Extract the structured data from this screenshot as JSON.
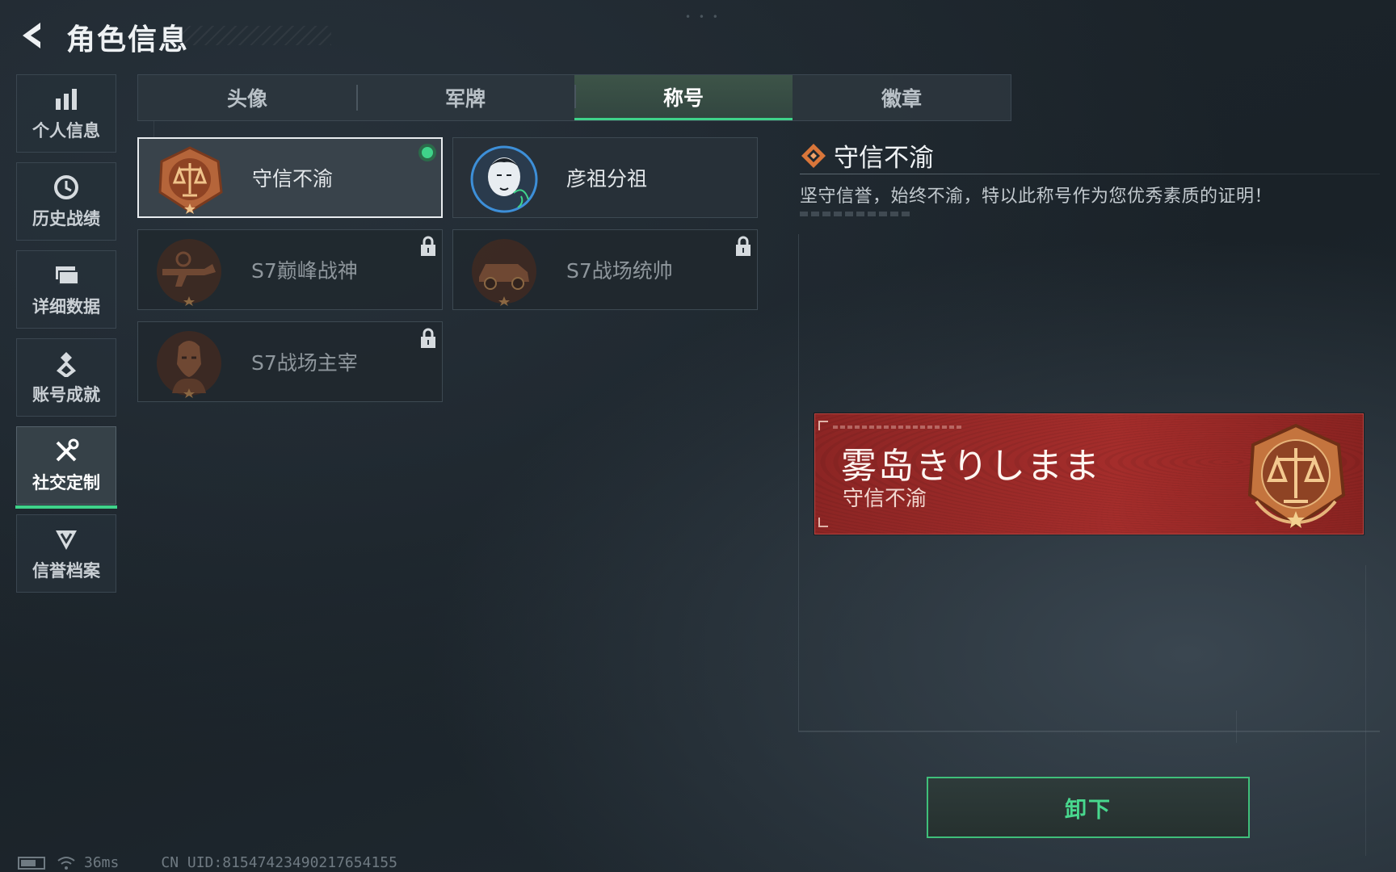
{
  "header": {
    "title": "角色信息",
    "back_icon": "back-arrow-icon"
  },
  "sidenav": {
    "items": [
      {
        "label": "个人信息",
        "icon": "bar-chart-icon"
      },
      {
        "label": "历史战绩",
        "icon": "history-clock-icon"
      },
      {
        "label": "详细数据",
        "icon": "folder-icon"
      },
      {
        "label": "账号成就",
        "icon": "medal-icon"
      },
      {
        "label": "社交定制",
        "icon": "tools-icon",
        "active": true
      },
      {
        "label": "信誉档案",
        "icon": "shield-chevron-icon"
      }
    ]
  },
  "tabs": [
    {
      "label": "头像"
    },
    {
      "label": "军牌"
    },
    {
      "label": "称号",
      "active": true
    },
    {
      "label": "徽章"
    }
  ],
  "titles": [
    {
      "name": "守信不渝",
      "state": "equipped",
      "icon": "scales-emblem-icon"
    },
    {
      "name": "彦祖分祖",
      "state": "unlocked",
      "icon": "portrait-emblem-icon"
    },
    {
      "name": "S7巅峰战神",
      "state": "locked",
      "icon": "weapon-emblem-icon"
    },
    {
      "name": "S7战场统帅",
      "state": "locked",
      "icon": "vehicle-emblem-icon"
    },
    {
      "name": "S7战场主宰",
      "state": "locked",
      "icon": "soldier-emblem-icon"
    }
  ],
  "detail": {
    "title": "守信不渝",
    "description": "坚守信誉，始终不渝，特以此称号作为您优秀素质的证明！",
    "icon": "diamond-icon"
  },
  "banner": {
    "player_name": "雾岛きりしまま",
    "title": "守信不渝",
    "icon": "scales-emblem-icon"
  },
  "actions": {
    "unequip_label": "卸下"
  },
  "status": {
    "ping": "36ms",
    "uid": "CN UID:815474234902176541​55"
  },
  "colors": {
    "accent": "#3fd38a",
    "banner_red": "#a42d2b",
    "emblem_bronze": "#b5653a"
  }
}
